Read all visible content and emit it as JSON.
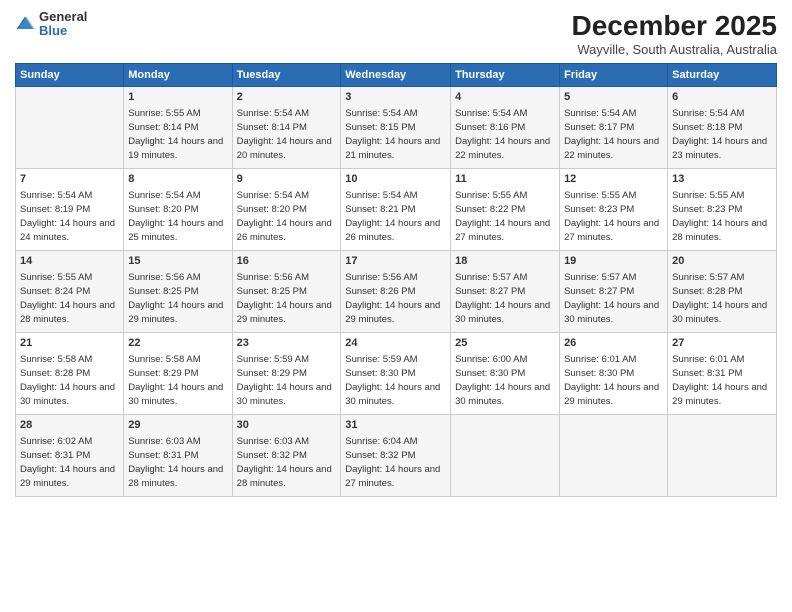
{
  "header": {
    "logo_general": "General",
    "logo_blue": "Blue",
    "title": "December 2025",
    "subtitle": "Wayville, South Australia, Australia"
  },
  "weekdays": [
    "Sunday",
    "Monday",
    "Tuesday",
    "Wednesday",
    "Thursday",
    "Friday",
    "Saturday"
  ],
  "weeks": [
    [
      {
        "day": "",
        "sunrise": "",
        "sunset": "",
        "daylight": "",
        "shade": true
      },
      {
        "day": "1",
        "sunrise": "Sunrise: 5:55 AM",
        "sunset": "Sunset: 8:14 PM",
        "daylight": "Daylight: 14 hours and 19 minutes.",
        "shade": true
      },
      {
        "day": "2",
        "sunrise": "Sunrise: 5:54 AM",
        "sunset": "Sunset: 8:14 PM",
        "daylight": "Daylight: 14 hours and 20 minutes.",
        "shade": true
      },
      {
        "day": "3",
        "sunrise": "Sunrise: 5:54 AM",
        "sunset": "Sunset: 8:15 PM",
        "daylight": "Daylight: 14 hours and 21 minutes.",
        "shade": true
      },
      {
        "day": "4",
        "sunrise": "Sunrise: 5:54 AM",
        "sunset": "Sunset: 8:16 PM",
        "daylight": "Daylight: 14 hours and 22 minutes.",
        "shade": true
      },
      {
        "day": "5",
        "sunrise": "Sunrise: 5:54 AM",
        "sunset": "Sunset: 8:17 PM",
        "daylight": "Daylight: 14 hours and 22 minutes.",
        "shade": true
      },
      {
        "day": "6",
        "sunrise": "Sunrise: 5:54 AM",
        "sunset": "Sunset: 8:18 PM",
        "daylight": "Daylight: 14 hours and 23 minutes.",
        "shade": true
      }
    ],
    [
      {
        "day": "7",
        "sunrise": "Sunrise: 5:54 AM",
        "sunset": "Sunset: 8:19 PM",
        "daylight": "Daylight: 14 hours and 24 minutes.",
        "shade": false
      },
      {
        "day": "8",
        "sunrise": "Sunrise: 5:54 AM",
        "sunset": "Sunset: 8:20 PM",
        "daylight": "Daylight: 14 hours and 25 minutes.",
        "shade": false
      },
      {
        "day": "9",
        "sunrise": "Sunrise: 5:54 AM",
        "sunset": "Sunset: 8:20 PM",
        "daylight": "Daylight: 14 hours and 26 minutes.",
        "shade": false
      },
      {
        "day": "10",
        "sunrise": "Sunrise: 5:54 AM",
        "sunset": "Sunset: 8:21 PM",
        "daylight": "Daylight: 14 hours and 26 minutes.",
        "shade": false
      },
      {
        "day": "11",
        "sunrise": "Sunrise: 5:55 AM",
        "sunset": "Sunset: 8:22 PM",
        "daylight": "Daylight: 14 hours and 27 minutes.",
        "shade": false
      },
      {
        "day": "12",
        "sunrise": "Sunrise: 5:55 AM",
        "sunset": "Sunset: 8:23 PM",
        "daylight": "Daylight: 14 hours and 27 minutes.",
        "shade": false
      },
      {
        "day": "13",
        "sunrise": "Sunrise: 5:55 AM",
        "sunset": "Sunset: 8:23 PM",
        "daylight": "Daylight: 14 hours and 28 minutes.",
        "shade": false
      }
    ],
    [
      {
        "day": "14",
        "sunrise": "Sunrise: 5:55 AM",
        "sunset": "Sunset: 8:24 PM",
        "daylight": "Daylight: 14 hours and 28 minutes.",
        "shade": true
      },
      {
        "day": "15",
        "sunrise": "Sunrise: 5:56 AM",
        "sunset": "Sunset: 8:25 PM",
        "daylight": "Daylight: 14 hours and 29 minutes.",
        "shade": true
      },
      {
        "day": "16",
        "sunrise": "Sunrise: 5:56 AM",
        "sunset": "Sunset: 8:25 PM",
        "daylight": "Daylight: 14 hours and 29 minutes.",
        "shade": true
      },
      {
        "day": "17",
        "sunrise": "Sunrise: 5:56 AM",
        "sunset": "Sunset: 8:26 PM",
        "daylight": "Daylight: 14 hours and 29 minutes.",
        "shade": true
      },
      {
        "day": "18",
        "sunrise": "Sunrise: 5:57 AM",
        "sunset": "Sunset: 8:27 PM",
        "daylight": "Daylight: 14 hours and 30 minutes.",
        "shade": true
      },
      {
        "day": "19",
        "sunrise": "Sunrise: 5:57 AM",
        "sunset": "Sunset: 8:27 PM",
        "daylight": "Daylight: 14 hours and 30 minutes.",
        "shade": true
      },
      {
        "day": "20",
        "sunrise": "Sunrise: 5:57 AM",
        "sunset": "Sunset: 8:28 PM",
        "daylight": "Daylight: 14 hours and 30 minutes.",
        "shade": true
      }
    ],
    [
      {
        "day": "21",
        "sunrise": "Sunrise: 5:58 AM",
        "sunset": "Sunset: 8:28 PM",
        "daylight": "Daylight: 14 hours and 30 minutes.",
        "shade": false
      },
      {
        "day": "22",
        "sunrise": "Sunrise: 5:58 AM",
        "sunset": "Sunset: 8:29 PM",
        "daylight": "Daylight: 14 hours and 30 minutes.",
        "shade": false
      },
      {
        "day": "23",
        "sunrise": "Sunrise: 5:59 AM",
        "sunset": "Sunset: 8:29 PM",
        "daylight": "Daylight: 14 hours and 30 minutes.",
        "shade": false
      },
      {
        "day": "24",
        "sunrise": "Sunrise: 5:59 AM",
        "sunset": "Sunset: 8:30 PM",
        "daylight": "Daylight: 14 hours and 30 minutes.",
        "shade": false
      },
      {
        "day": "25",
        "sunrise": "Sunrise: 6:00 AM",
        "sunset": "Sunset: 8:30 PM",
        "daylight": "Daylight: 14 hours and 30 minutes.",
        "shade": false
      },
      {
        "day": "26",
        "sunrise": "Sunrise: 6:01 AM",
        "sunset": "Sunset: 8:30 PM",
        "daylight": "Daylight: 14 hours and 29 minutes.",
        "shade": false
      },
      {
        "day": "27",
        "sunrise": "Sunrise: 6:01 AM",
        "sunset": "Sunset: 8:31 PM",
        "daylight": "Daylight: 14 hours and 29 minutes.",
        "shade": false
      }
    ],
    [
      {
        "day": "28",
        "sunrise": "Sunrise: 6:02 AM",
        "sunset": "Sunset: 8:31 PM",
        "daylight": "Daylight: 14 hours and 29 minutes.",
        "shade": true
      },
      {
        "day": "29",
        "sunrise": "Sunrise: 6:03 AM",
        "sunset": "Sunset: 8:31 PM",
        "daylight": "Daylight: 14 hours and 28 minutes.",
        "shade": true
      },
      {
        "day": "30",
        "sunrise": "Sunrise: 6:03 AM",
        "sunset": "Sunset: 8:32 PM",
        "daylight": "Daylight: 14 hours and 28 minutes.",
        "shade": true
      },
      {
        "day": "31",
        "sunrise": "Sunrise: 6:04 AM",
        "sunset": "Sunset: 8:32 PM",
        "daylight": "Daylight: 14 hours and 27 minutes.",
        "shade": true
      },
      {
        "day": "",
        "sunrise": "",
        "sunset": "",
        "daylight": "",
        "shade": true
      },
      {
        "day": "",
        "sunrise": "",
        "sunset": "",
        "daylight": "",
        "shade": true
      },
      {
        "day": "",
        "sunrise": "",
        "sunset": "",
        "daylight": "",
        "shade": true
      }
    ]
  ]
}
